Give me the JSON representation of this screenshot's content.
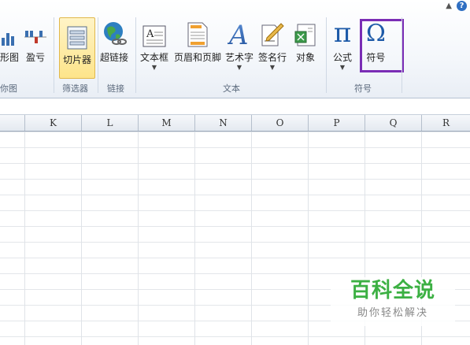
{
  "topbar": {
    "help_label": "?"
  },
  "ribbon": {
    "buttons": {
      "chart_partial": "形图",
      "winloss": "盈亏",
      "slicer": "切片器",
      "hyperlink": "超链接",
      "textbox": "文本框",
      "header_footer": "页眉和页脚",
      "wordart": "艺术字",
      "signature_line": "签名行",
      "object": "对象",
      "equation": "公式",
      "symbol": "符号"
    },
    "groups": {
      "sparklines_partial": "你图",
      "filter": "筛选器",
      "links": "链接",
      "text": "文本",
      "symbols": "符号"
    },
    "icons": {
      "equation_glyph": "π",
      "symbol_glyph": "Ω",
      "textbox_glyph": "A",
      "wordart_glyph": "A"
    },
    "selected_color": "#fde48a",
    "highlight_color": "#7a2db5"
  },
  "columns": [
    "K",
    "L",
    "M",
    "N",
    "O",
    "P",
    "Q",
    "R"
  ],
  "watermark": {
    "title": "百科全说",
    "subtitle": "助你轻松解决",
    "color": "#3cb043"
  }
}
